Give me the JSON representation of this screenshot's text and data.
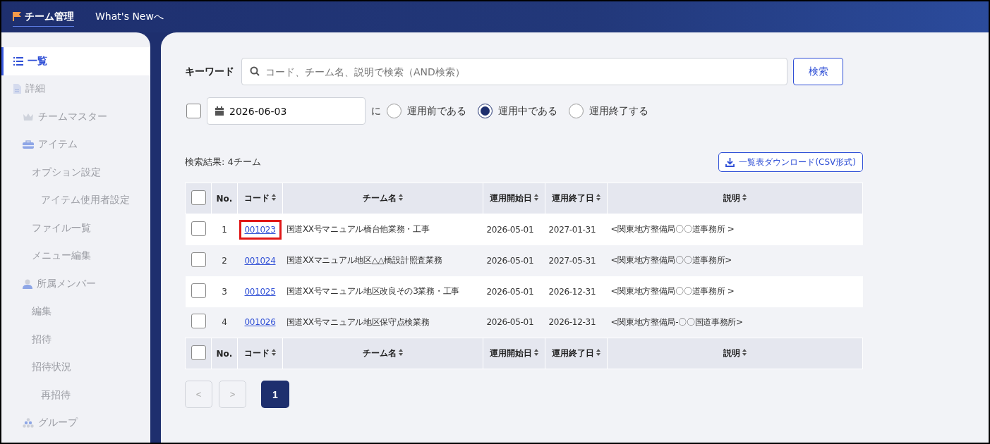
{
  "header": {
    "title": "チーム管理",
    "link": "What's Newへ"
  },
  "sidebar": {
    "items": [
      {
        "label": "一覧",
        "kind": "list",
        "selected": true
      },
      {
        "label": "詳細",
        "kind": "document",
        "selected": false,
        "children": [
          {
            "label": "チームマスター",
            "kind": "crown",
            "selected": false
          },
          {
            "label": "アイテム",
            "kind": "toolbox",
            "selected": false,
            "children": [
              {
                "label": "オプション設定",
                "selected": false,
                "children": [
                  {
                    "label": "アイテム使用者設定",
                    "selected": false
                  }
                ]
              },
              {
                "label": "ファイル一覧",
                "selected": false
              },
              {
                "label": "メニュー編集",
                "selected": false
              }
            ]
          },
          {
            "label": "所属メンバー",
            "kind": "person",
            "selected": false,
            "children": [
              {
                "label": "編集",
                "selected": false
              },
              {
                "label": "招待",
                "selected": false
              },
              {
                "label": "招待状況",
                "selected": false,
                "children": [
                  {
                    "label": "再招待",
                    "selected": false
                  }
                ]
              }
            ]
          },
          {
            "label": "グループ",
            "kind": "group",
            "selected": false
          }
        ]
      }
    ]
  },
  "search": {
    "label": "キーワード",
    "placeholder": "コード、チーム名、説明で検索（AND検索）",
    "button": "検索"
  },
  "date_filter": {
    "checked": false,
    "date": "2026-06-03",
    "particle": "に",
    "options": [
      {
        "label": "運用前である",
        "selected": false
      },
      {
        "label": "運用中である",
        "selected": true
      },
      {
        "label": "運用終了する",
        "selected": false
      }
    ]
  },
  "result_count": "検索結果: 4チーム",
  "download_button": "一覧表ダウンロード(CSV形式)",
  "table": {
    "columns": [
      "No.",
      "コード",
      "チーム名",
      "運用開始日",
      "運用終了日",
      "説明"
    ],
    "rows": [
      {
        "checked": false,
        "no": "1",
        "code": "001023",
        "highlighted": true,
        "name": "国道XX号マニュアル橋台他業務・工事",
        "start": "2026-05-01",
        "end": "2027-01-31",
        "description": "<関東地方整備局〇〇道事務所 >"
      },
      {
        "checked": false,
        "no": "2",
        "code": "001024",
        "highlighted": false,
        "name": "国道XXマニュアル地区△△橋設計照査業務",
        "start": "2026-05-01",
        "end": "2027-05-31",
        "description": "<関東地方整備局〇〇道事務所>"
      },
      {
        "checked": false,
        "no": "3",
        "code": "001025",
        "highlighted": false,
        "name": "国道XX号マニュアル地区改良その3業務・工事",
        "start": "2026-05-01",
        "end": "2026-12-31",
        "description": "<関東地方整備局〇〇道事務所 >"
      },
      {
        "checked": false,
        "no": "4",
        "code": "001026",
        "highlighted": false,
        "name": "国道XX号マニュアル地区保守点検業務",
        "start": "2026-05-01",
        "end": "2026-12-31",
        "description": "<関東地方整備局-〇〇国道事務所>"
      }
    ],
    "footer_columns": [
      "No.",
      "コード",
      "チーム名",
      "運用開始日",
      "運用終了日",
      "説明"
    ],
    "footer_checked": false,
    "header_checked": false
  },
  "pagination": {
    "prev": "<",
    "next": ">",
    "pages": [
      {
        "label": "1",
        "selected": true
      }
    ]
  }
}
